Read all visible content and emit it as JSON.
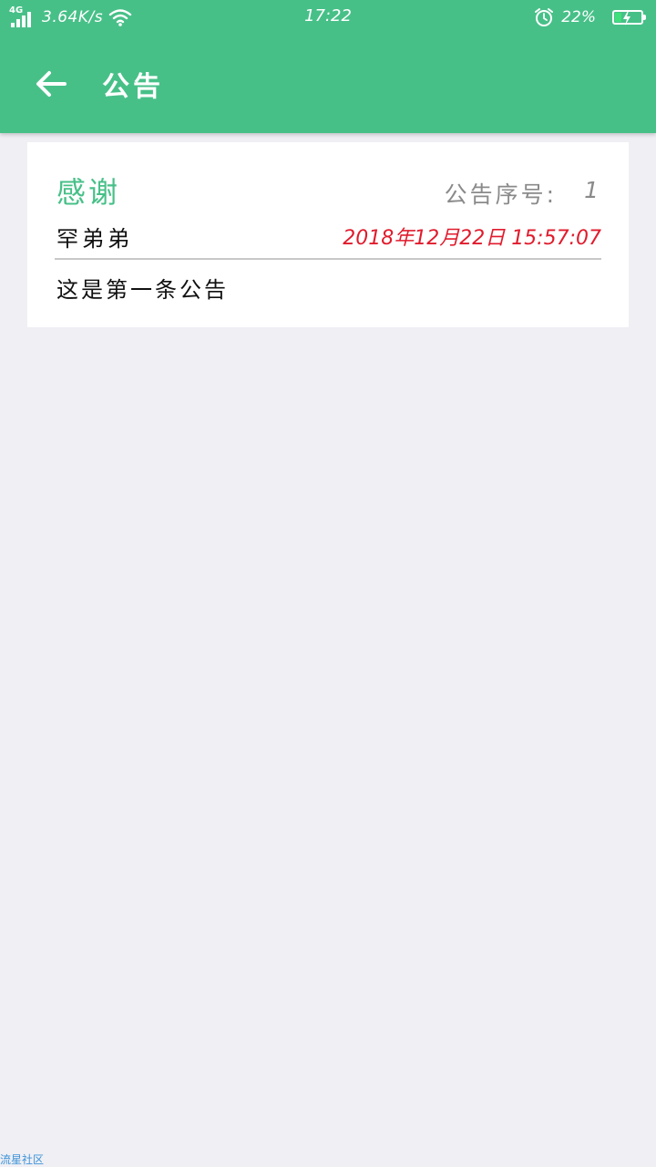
{
  "status_bar": {
    "network_type": "4G",
    "speed": "3.64K/s",
    "time": "17:22",
    "battery_percent": "22%",
    "battery_level": 0.22
  },
  "header": {
    "title": "公告"
  },
  "announcement": {
    "title": "感谢",
    "seq_label": "公告序号:",
    "seq_value": "1",
    "author": "罕弟弟",
    "date": "2018年12月22日 15:57:07",
    "content": "这是第一条公告"
  },
  "footer": {
    "watermark": "流星社区"
  },
  "colors": {
    "primary": "#47c088",
    "date": "#e01b2c",
    "background": "#efeff4"
  }
}
